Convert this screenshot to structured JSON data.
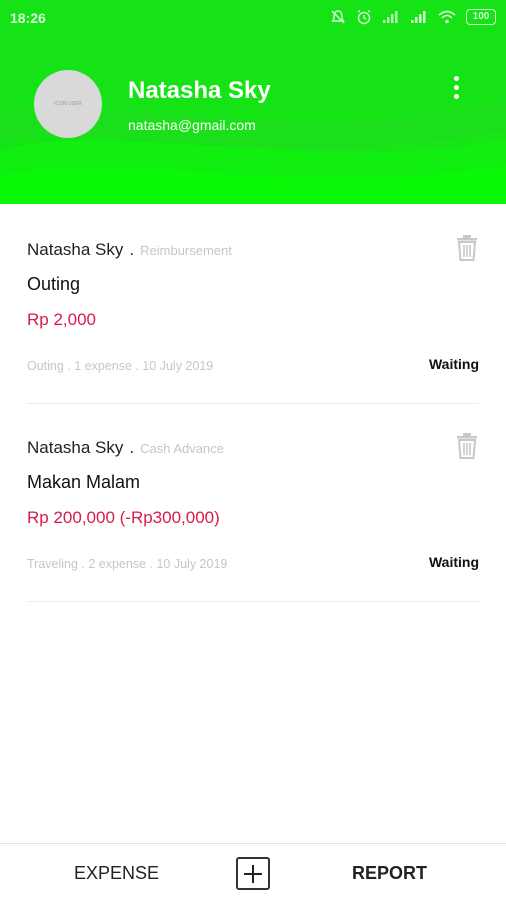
{
  "status_bar": {
    "time": "18:26",
    "battery": "100"
  },
  "profile": {
    "avatar_text": "ICON USER",
    "name": "Natasha Sky",
    "email": "natasha@gmail.com"
  },
  "requests": [
    {
      "requester": "Natasha Sky",
      "separator": ".",
      "type": "Reimbursement",
      "title": "Outing",
      "amount": "Rp 2,000",
      "meta": "Outing . 1 expense . 10 July 2019",
      "status": "Waiting"
    },
    {
      "requester": "Natasha Sky",
      "separator": ".",
      "type": "Cash Advance",
      "title": "Makan Malam",
      "amount": "Rp 200,000 (-Rp300,000)",
      "meta": "Traveling . 2 expense . 10 July 2019",
      "status": "Waiting"
    }
  ],
  "bottom_bar": {
    "expense_label": "EXPENSE",
    "report_label": "REPORT"
  },
  "colors": {
    "header_green": "#16e316",
    "amount_red": "#d81b4a"
  },
  "icons": {
    "menu": "more-vert-icon",
    "delete": "trash-icon",
    "add": "plus-box-icon"
  }
}
